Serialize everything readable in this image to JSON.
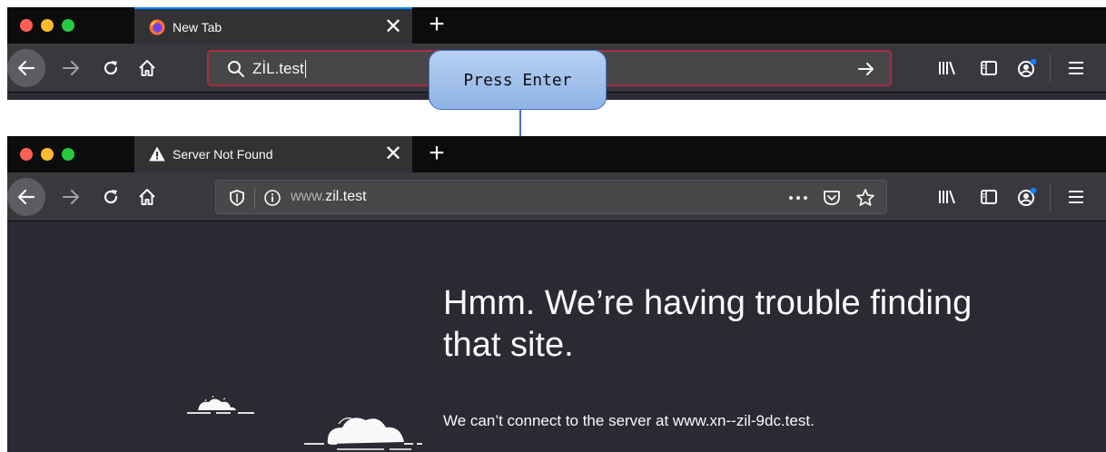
{
  "top_window": {
    "tab": {
      "label": "New Tab",
      "icon": "firefox-logo-icon",
      "close": "✕"
    },
    "new_tab": "+",
    "urlbar": {
      "value": "ZİL.test",
      "search_icon": "search-icon",
      "go_icon": "arrow-right-icon"
    },
    "toolbar_icons": [
      "library-icon",
      "sidebar-icon",
      "account-icon",
      "menu-icon"
    ]
  },
  "callout": {
    "text": "Press Enter"
  },
  "bottom_window": {
    "tab": {
      "label": "Server Not Found",
      "icon": "warning-icon",
      "close": "✕"
    },
    "new_tab": "+",
    "urlbar": {
      "prefix": "www.",
      "domain": "zil.test",
      "shield_icon": "tracking-shield-icon",
      "info_icon": "info-icon",
      "page_actions": [
        "more-icon",
        "pocket-icon",
        "bookmark-star-icon"
      ]
    },
    "toolbar_icons": [
      "library-icon",
      "sidebar-icon",
      "account-icon",
      "menu-icon"
    ],
    "error": {
      "title": "Hmm. We’re having trouble finding that site.",
      "description": "We can’t connect to the server at www.xn--zil-9dc.test."
    }
  },
  "colors": {
    "tabbar_bg": "#0c0c0d",
    "toolbar_bg": "#38383d",
    "urlbar_bg": "#474749",
    "urlbar_error_border": "#a72e41",
    "page_bg": "#2b2a33",
    "callout_fill": "#a9c6ee",
    "callout_arrow": "#4472c4",
    "accent_blue": "#0a84ff"
  }
}
